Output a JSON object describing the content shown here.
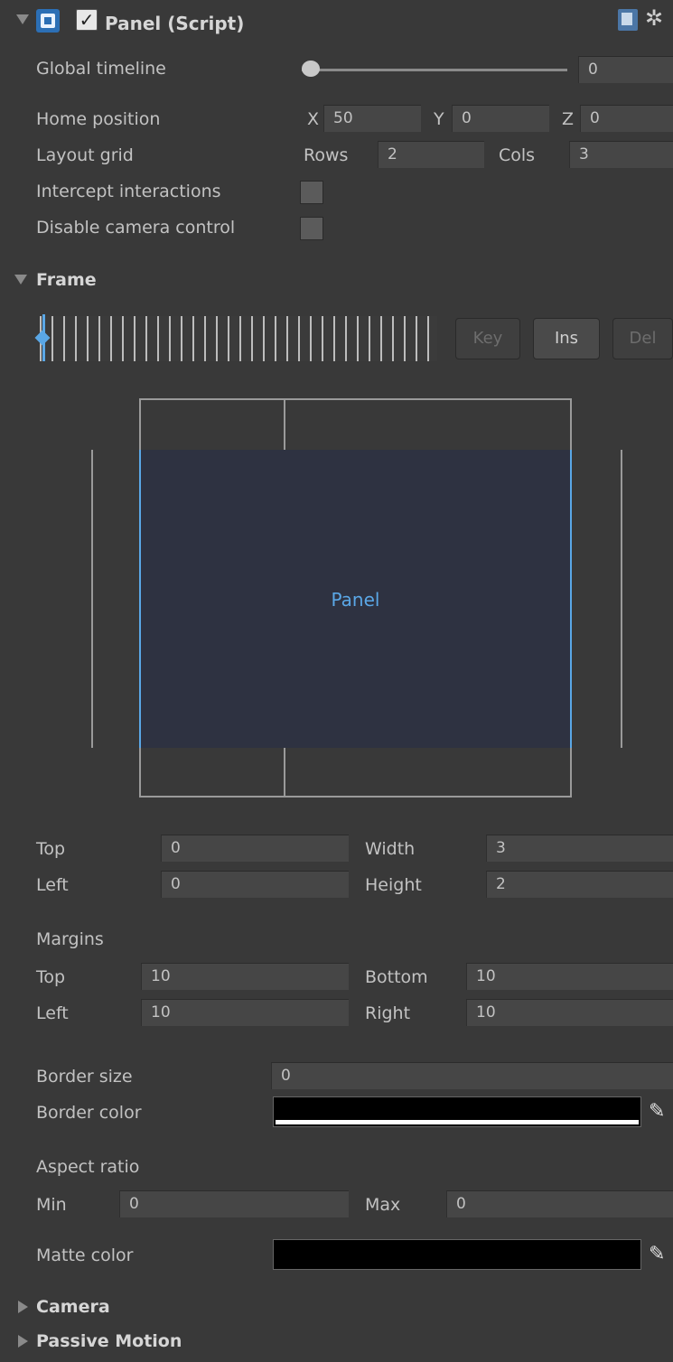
{
  "header": {
    "title": "Panel (Script)",
    "enabled": true
  },
  "fields": {
    "global_timeline": {
      "label": "Global timeline",
      "value": "0",
      "slider_fraction": 0
    },
    "home_position": {
      "label": "Home position",
      "x_label": "X",
      "x": "50",
      "y_label": "Y",
      "y": "0",
      "z_label": "Z",
      "z": "0"
    },
    "layout_grid": {
      "label": "Layout grid",
      "rows_label": "Rows",
      "rows": "2",
      "cols_label": "Cols",
      "cols": "3"
    },
    "intercept_interactions": {
      "label": "Intercept interactions",
      "checked": false
    },
    "disable_camera_control": {
      "label": "Disable camera control",
      "checked": false
    }
  },
  "frame": {
    "title": "Frame",
    "buttons": {
      "key": "Key",
      "ins": "Ins",
      "del": "Del"
    },
    "preview_label": "Panel",
    "top_label": "Top",
    "top": "0",
    "width_label": "Width",
    "width": "3",
    "left_label": "Left",
    "left": "0",
    "height_label": "Height",
    "height": "2",
    "margins_label": "Margins",
    "m_top_label": "Top",
    "m_top": "10",
    "m_bottom_label": "Bottom",
    "m_bottom": "10",
    "m_left_label": "Left",
    "m_left": "10",
    "m_right_label": "Right",
    "m_right": "10",
    "border_size_label": "Border size",
    "border_size": "0",
    "border_color_label": "Border color",
    "border_color": "#000000",
    "aspect_label": "Aspect ratio",
    "min_label": "Min",
    "min": "0",
    "max_label": "Max",
    "max": "0",
    "matte_color_label": "Matte color",
    "matte_color": "#000000"
  },
  "sections": {
    "camera": "Camera",
    "passive_motion": "Passive Motion"
  },
  "colors": {
    "accent": "#5aa7e6",
    "preview_fill": "#2e3241",
    "background": "#393939"
  }
}
